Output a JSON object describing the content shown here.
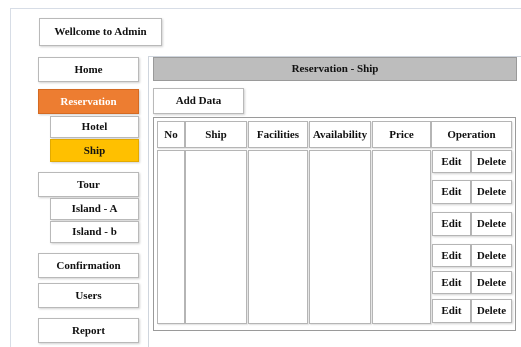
{
  "header": {
    "welcome": "Wellcome to Admin"
  },
  "sidebar": {
    "home": "Home",
    "reservation": "Reservation",
    "hotel": "Hotel",
    "ship": "Ship",
    "tour": "Tour",
    "island_a": "Island - A",
    "island_b": "Island - b",
    "confirmation": "Confirmation",
    "users": "Users",
    "report": "Report"
  },
  "main": {
    "title": "Reservation - Ship",
    "add_data_label": "Add Data",
    "table": {
      "headers": [
        "No",
        "Ship",
        "Facilities",
        "Availability",
        "Price",
        "Operation"
      ],
      "row_actions": [
        {
          "edit": "Edit",
          "delete": "Delete"
        },
        {
          "edit": "Edit",
          "delete": "Delete"
        },
        {
          "edit": "Edit",
          "delete": "Delete"
        },
        {
          "edit": "Edit",
          "delete": "Delete"
        },
        {
          "edit": "Edit",
          "delete": "Delete"
        },
        {
          "edit": "Edit",
          "delete": "Delete"
        }
      ]
    }
  },
  "colors": {
    "active_section": "#ed7d31",
    "active_item": "#ffc000",
    "title_bar": "#bdbdbd"
  }
}
